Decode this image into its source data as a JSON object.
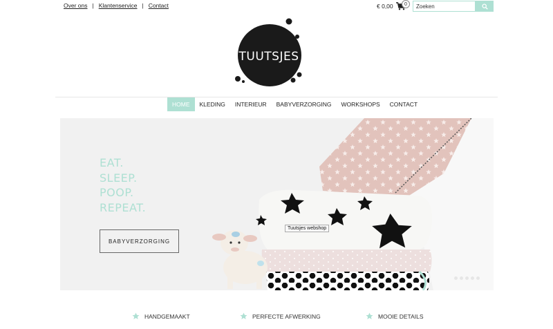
{
  "topbar": {
    "links": [
      "Over ons",
      "Klantenservice",
      "Contact"
    ],
    "separator": "|",
    "cart_total": "€ 0,00",
    "cart_count": "0",
    "search_placeholder": "Zoeken"
  },
  "logo": {
    "text": "TUUTSJES"
  },
  "nav": {
    "items": [
      "HOME",
      "KLEDING",
      "INTERIEUR",
      "BABYVERZORGING",
      "WORKSHOPS",
      "CONTACT"
    ],
    "active_index": 0
  },
  "hero": {
    "tagline": [
      "EAT.",
      "SLEEP.",
      "POOP.",
      "REPEAT."
    ],
    "button_label": "BABYVERZORGING",
    "tooltip": "Tuutsjes webshop",
    "slide_count": 5
  },
  "features": [
    "HANDGEMAAKT",
    "PERFECTE AFWERKING",
    "MOOIE DETAILS"
  ],
  "colors": {
    "accent": "#aee0d3",
    "logo": "#1a1a1a"
  }
}
